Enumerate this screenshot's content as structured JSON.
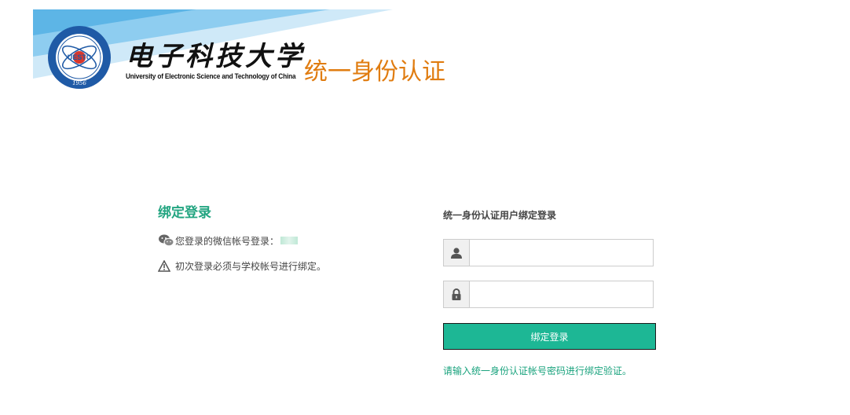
{
  "header": {
    "school_name_cn": "电子科技大学",
    "school_name_en": "University of Electronic Science and Technology of China",
    "logo_text": "UESTC",
    "logo_year": "1956",
    "system_title": "统一身份认证"
  },
  "left_panel": {
    "title": "绑定登录",
    "wechat_label": "您登录的微信帐号登录：",
    "notice": "初次登录必须与学校帐号进行绑定。",
    "icons": {
      "wechat": "wechat-icon",
      "warning": "warning-icon"
    }
  },
  "login_form": {
    "heading": "统一身份认证用户绑定登录",
    "username": {
      "value": "",
      "placeholder": "",
      "icon": "user-icon"
    },
    "password": {
      "value": "",
      "placeholder": "",
      "icon": "lock-icon"
    },
    "submit_label": "绑定登录",
    "hint": "请输入统一身份认证帐号密码进行绑定验证。"
  },
  "colors": {
    "accent_green": "#1db795",
    "title_green": "#23a581",
    "system_title_orange": "#e07c10",
    "banner_blue": "#4fa8de",
    "banner_light_blue": "#a9d8f2"
  }
}
